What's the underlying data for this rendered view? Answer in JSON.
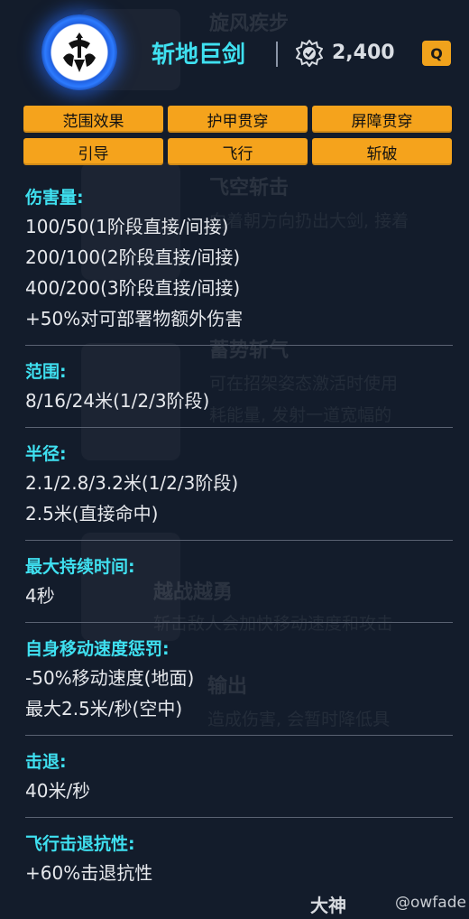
{
  "ability": {
    "name": "斩地巨剑",
    "cost": "2,400",
    "hotkey": "Q"
  },
  "tags": [
    "范围效果",
    "护甲贯穿",
    "屏障贯穿",
    "引导",
    "飞行",
    "斩破"
  ],
  "stats": [
    {
      "title": "伤害量:",
      "lines": [
        "100/50(1阶段直接/间接)",
        "200/100(2阶段直接/间接)",
        "400/200(3阶段直接/间接)",
        "+50%对可部署物额外伤害"
      ]
    },
    {
      "title": "范围:",
      "lines": [
        "8/16/24米(1/2/3阶段)"
      ]
    },
    {
      "title": "半径:",
      "lines": [
        "2.1/2.8/3.2米(1/2/3阶段)",
        "2.5米(直接命中)"
      ]
    },
    {
      "title": "最大持续时间:",
      "lines": [
        "4秒"
      ]
    },
    {
      "title": "自身移动速度惩罚:",
      "lines": [
        "-50%移动速度(地面)",
        "最大2.5米/秒(空中)"
      ]
    },
    {
      "title": "击退:",
      "lines": [
        "40米/秒"
      ]
    },
    {
      "title": "飞行击退抗性:",
      "lines": [
        "+60%击退抗性"
      ]
    }
  ],
  "background": {
    "ghost_titles": [
      "旋风疾步",
      "飞空斩击",
      "蓄势斩气",
      "越战越勇",
      "输出"
    ],
    "ghost_lines": [
      "向着朝方向扔出大剑, 接着",
      "可在招架姿态激活时使用",
      "耗能量, 发射一道宽幅的",
      "斩击敌人会加快移动速度和攻击",
      "造成伤害, 会暂时降低具"
    ]
  },
  "watermark": {
    "brand": "大神",
    "handle": "@owfade"
  },
  "colors": {
    "accent_cyan": "#3fe0f0",
    "tag_orange": "#f5a31c",
    "background": "#131c2b",
    "icon_glow": "#2d7bff"
  },
  "icons": {
    "ability": "sword-emblem-icon",
    "cost": "credit-coin-icon"
  }
}
